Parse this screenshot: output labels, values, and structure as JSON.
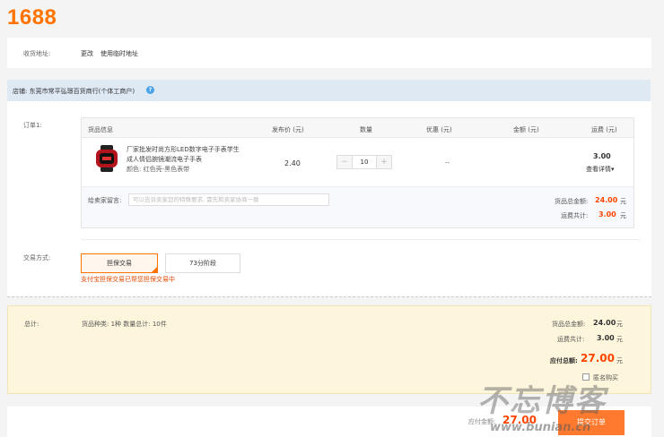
{
  "logo": "1688",
  "address": {
    "label": "收货地址:",
    "link_change": "更改",
    "link_temp": "使用临时地址"
  },
  "shop": {
    "label": "店铺: 东莞市常平弘璟百货商行(个体工商户)",
    "help_icon": "question-circle-icon"
  },
  "order": {
    "label": "订单1:",
    "headers": [
      "货品信息",
      "发布价 (元)",
      "数量",
      "优惠 (元)",
      "金额 (元)",
      "运费 (元)"
    ],
    "product": {
      "title_line1": "厂家批发时尚方形LED数字电子手表学生",
      "title_line2": "成人情侣腕镜潮流电子手表",
      "spec": "颜色: 红色壳-黑色表带",
      "price": "2.40",
      "qty": "10",
      "qty_minus": "−",
      "qty_plus": "+",
      "discount": "--",
      "shipping": "3.00",
      "shipping_detail": "查看详情▾"
    },
    "message": {
      "label": "给卖家留言:",
      "placeholder": "可以告诉卖家您的特殊要求, 需先和卖家协商一致"
    },
    "goods_total_label": "货品总金额:",
    "goods_total": "24.00",
    "unit": "元",
    "ship_total_label": "运费共计:",
    "ship_total": "3.00"
  },
  "trade": {
    "label": "交易方式:",
    "option_a": "担保交易",
    "option_b": "73分阶段",
    "note": "支付宝担保交易已帮您担保交易中"
  },
  "summary": {
    "label": "总计:",
    "counts": "货品种类: 1种  数量总计: 10件",
    "goods_total_label": "货品总金额:",
    "goods_total": "24.00",
    "unit": "元",
    "ship_total_label": "运费共计:",
    "ship_total": "3.00",
    "pay_label": "应付总额:",
    "pay_total": "27.00",
    "anonymous": "匿名购买"
  },
  "bottom": {
    "pay_label": "应付金额:",
    "pay_total": "27.00",
    "submit": "提交订单"
  },
  "watermark": {
    "big": "不忘博客",
    "small": "www.bunian.cn"
  },
  "colors": {
    "brand": "#ff7300",
    "price": "#ff4400",
    "shop_bar": "#dfe9f4",
    "summary_bg": "#fdf6dc"
  }
}
